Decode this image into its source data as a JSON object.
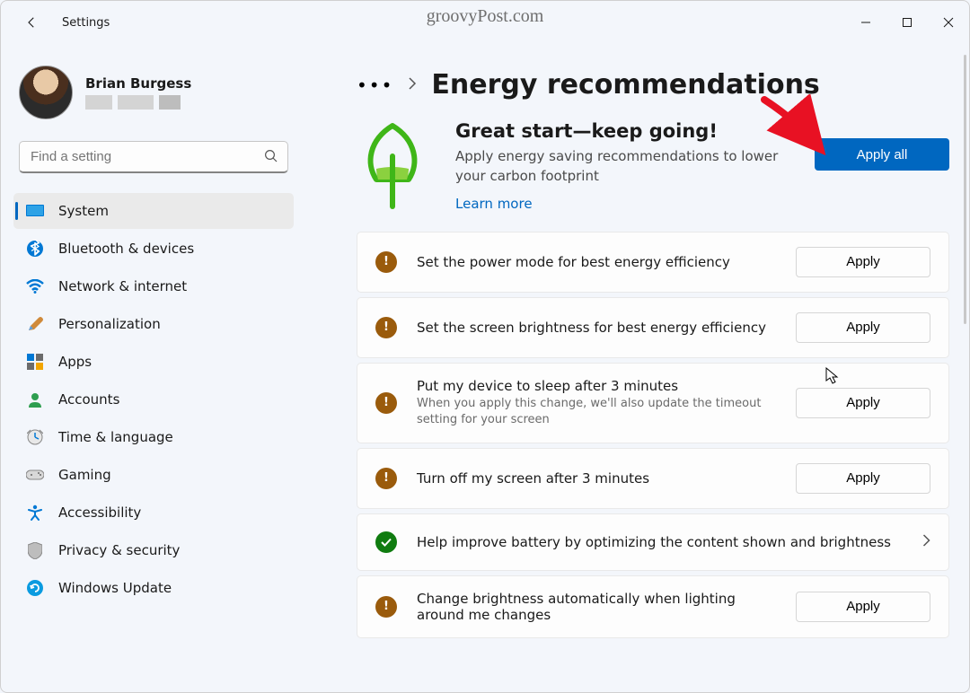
{
  "window": {
    "title": "Settings",
    "watermark": "groovyPost.com"
  },
  "user": {
    "name": "Brian Burgess"
  },
  "search": {
    "placeholder": "Find a setting"
  },
  "nav": [
    {
      "id": "system",
      "label": "System",
      "active": true
    },
    {
      "id": "bluetooth",
      "label": "Bluetooth & devices"
    },
    {
      "id": "network",
      "label": "Network & internet"
    },
    {
      "id": "personalization",
      "label": "Personalization"
    },
    {
      "id": "apps",
      "label": "Apps"
    },
    {
      "id": "accounts",
      "label": "Accounts"
    },
    {
      "id": "time",
      "label": "Time & language"
    },
    {
      "id": "gaming",
      "label": "Gaming"
    },
    {
      "id": "accessibility",
      "label": "Accessibility"
    },
    {
      "id": "privacy",
      "label": "Privacy & security"
    },
    {
      "id": "update",
      "label": "Windows Update"
    }
  ],
  "page": {
    "title": "Energy recommendations",
    "hero_title": "Great start—keep going!",
    "hero_desc": "Apply energy saving recommendations to lower your carbon footprint",
    "learn_more": "Learn more",
    "apply_all": "Apply all"
  },
  "recommendations": [
    {
      "status": "warn",
      "title": "Set the power mode for best energy efficiency",
      "sub": "",
      "action": "Apply"
    },
    {
      "status": "warn",
      "title": "Set the screen brightness for best energy efficiency",
      "sub": "",
      "action": "Apply"
    },
    {
      "status": "warn",
      "title": "Put my device to sleep after 3 minutes",
      "sub": "When you apply this change, we'll also update the timeout setting for your screen",
      "action": "Apply"
    },
    {
      "status": "warn",
      "title": "Turn off my screen after 3 minutes",
      "sub": "",
      "action": "Apply"
    },
    {
      "status": "ok",
      "title": "Help improve battery by optimizing the content shown and brightness",
      "sub": "",
      "action": "chevron"
    },
    {
      "status": "warn",
      "title": "Change brightness automatically when lighting around me changes",
      "sub": "",
      "action": "Apply"
    }
  ]
}
